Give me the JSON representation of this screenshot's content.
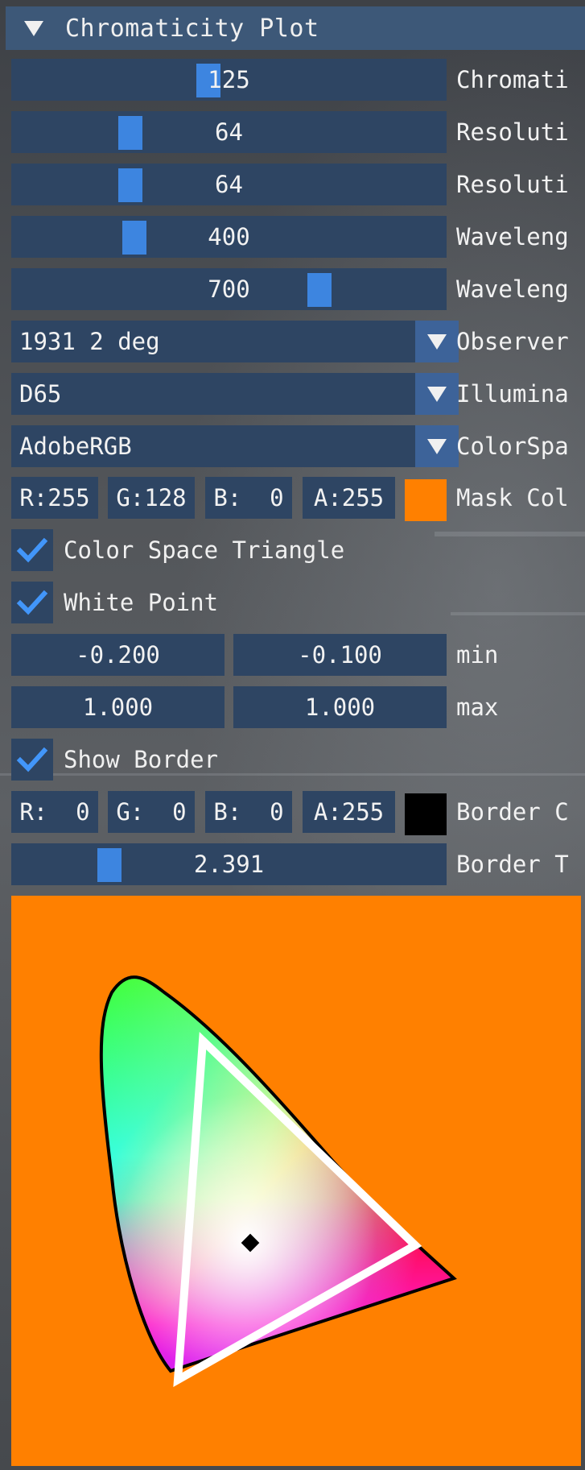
{
  "header": {
    "title": "Chromaticity Plot"
  },
  "sliders": {
    "chromaticity_size": {
      "value": "125",
      "label": "Chromati",
      "fill": 0.45
    },
    "resolution_x": {
      "value": "64",
      "label": "Resoluti",
      "fill": 0.26
    },
    "resolution_y": {
      "value": "64",
      "label": "Resoluti",
      "fill": 0.26
    },
    "wavelength_min": {
      "value": "400",
      "label": "Waveleng",
      "fill": 0.27
    },
    "wavelength_max": {
      "value": "700",
      "label": "Waveleng",
      "fill": 0.72
    }
  },
  "combos": {
    "observer": {
      "value": "1931 2 deg",
      "label": "Observer"
    },
    "illuminant": {
      "value": "D65",
      "label": "Illumina"
    },
    "colorspace": {
      "value": "AdobeRGB",
      "label": "ColorSpa"
    }
  },
  "mask_color": {
    "r": "R:255",
    "g": "G:128",
    "b": "B:  0",
    "a": "A:255",
    "label": "Mask Col",
    "swatch": "#ff8000"
  },
  "checkboxes": {
    "triangle": {
      "label": "Color Space Triangle",
      "checked": true
    },
    "white_point": {
      "label": "White Point",
      "checked": true
    },
    "show_border": {
      "label": "Show Border",
      "checked": true
    }
  },
  "range": {
    "min": {
      "x": "-0.200",
      "y": "-0.100",
      "label": "min"
    },
    "max": {
      "x": "1.000",
      "y": "1.000",
      "label": "max"
    }
  },
  "border_color": {
    "r": "R:  0",
    "g": "G:  0",
    "b": "B:  0",
    "a": "A:255",
    "label": "Border C",
    "swatch": "#000000"
  },
  "border_thickness": {
    "value": "2.391",
    "label": "Border T",
    "fill": 0.21
  },
  "colors": {
    "frame_bg": "#2e4563",
    "header_bg": "#3d5878",
    "accent": "#3d85e0",
    "check": "#4296fa",
    "plot_bg": "#ff8000"
  }
}
